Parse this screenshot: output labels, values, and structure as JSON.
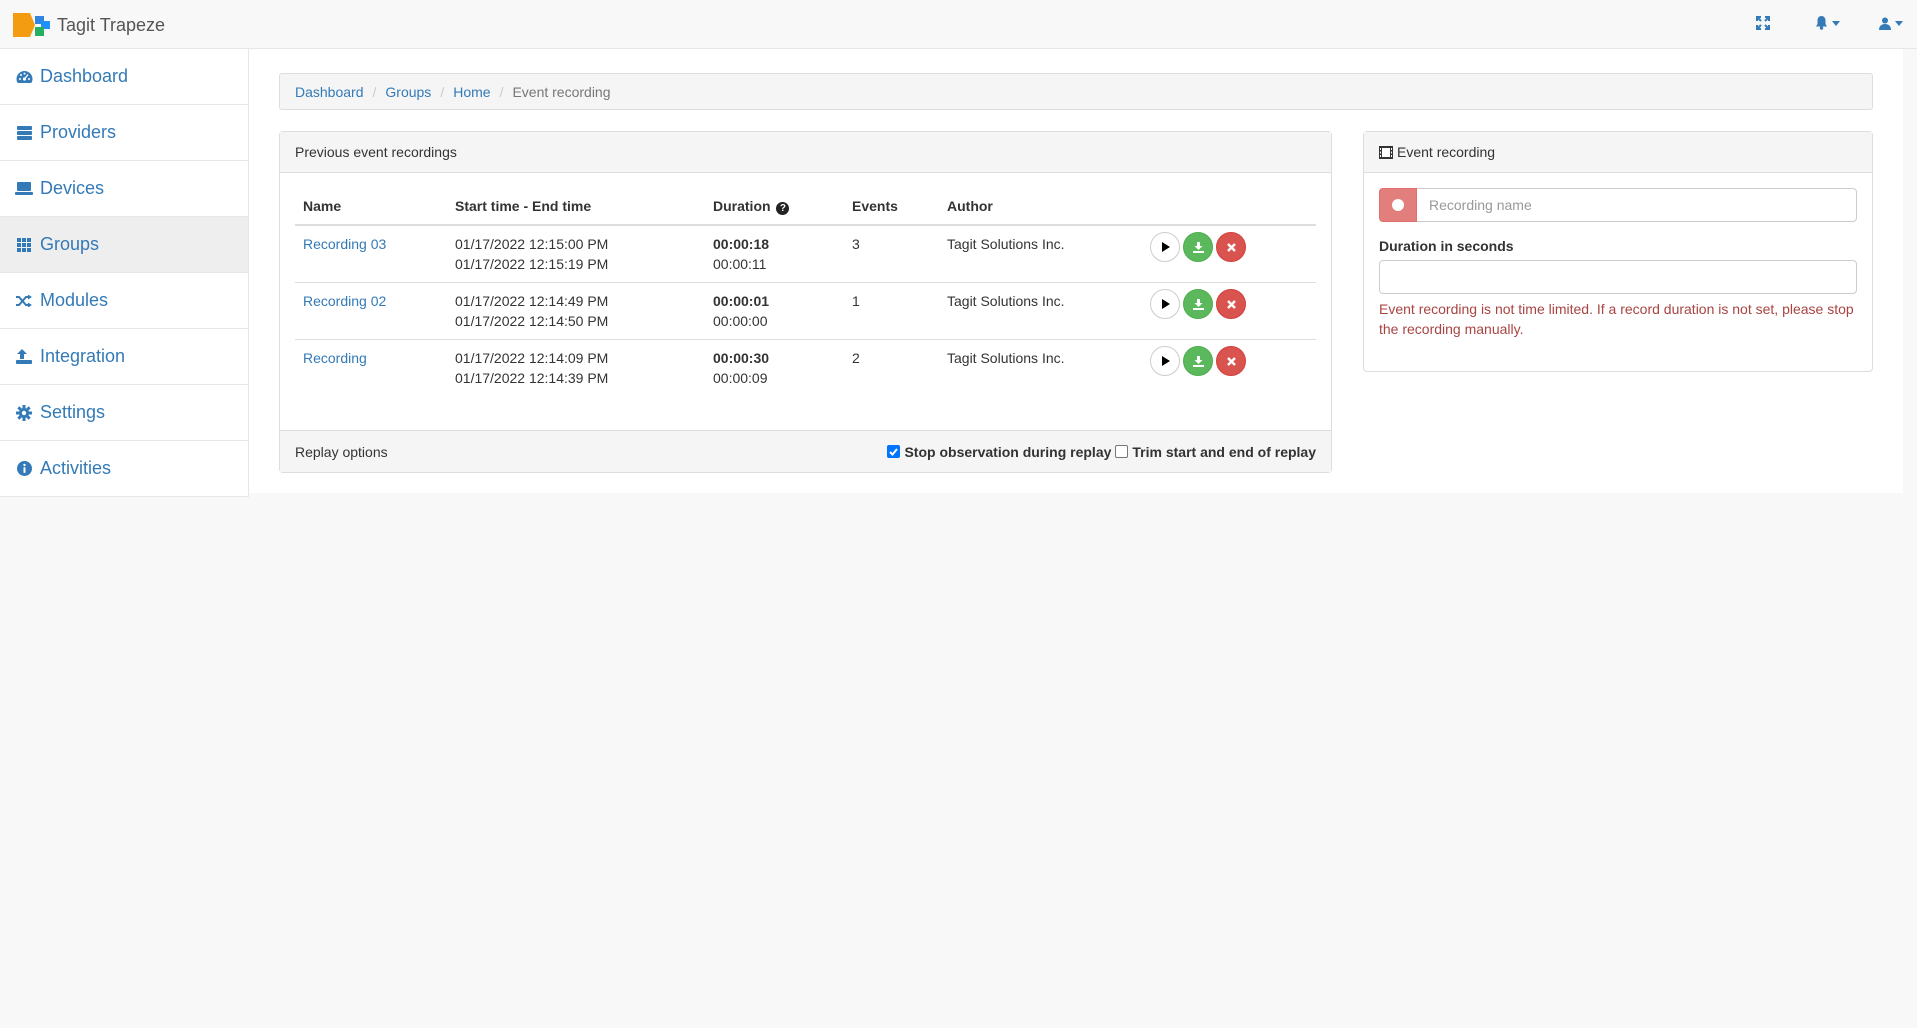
{
  "app": {
    "name": "Tagit Trapeze"
  },
  "colors": {
    "primary": "#337ab7",
    "success": "#5cb85c",
    "danger": "#d9534f",
    "error_text": "#a94442"
  },
  "sidebar": {
    "items": [
      {
        "label": "Dashboard",
        "icon": "dashboard-icon"
      },
      {
        "label": "Providers",
        "icon": "server-icon"
      },
      {
        "label": "Devices",
        "icon": "laptop-icon"
      },
      {
        "label": "Groups",
        "icon": "grid-icon",
        "active": true
      },
      {
        "label": "Modules",
        "icon": "random-icon"
      },
      {
        "label": "Integration",
        "icon": "sign-in-icon"
      },
      {
        "label": "Settings",
        "icon": "gear-icon"
      },
      {
        "label": "Activities",
        "icon": "info-icon"
      }
    ]
  },
  "breadcrumb": {
    "items": [
      "Dashboard",
      "Groups",
      "Home"
    ],
    "current": "Event recording"
  },
  "recordings_panel": {
    "title": "Previous event recordings",
    "columns": {
      "name": "Name",
      "time": "Start time - End time",
      "duration": "Duration",
      "events": "Events",
      "author": "Author"
    },
    "rows": [
      {
        "name": "Recording 03",
        "start": "01/17/2022 12:15:00 PM",
        "end": "01/17/2022 12:15:19 PM",
        "duration": "00:00:18",
        "duration2": "00:00:11",
        "events": "3",
        "author": "Tagit Solutions Inc."
      },
      {
        "name": "Recording 02",
        "start": "01/17/2022 12:14:49 PM",
        "end": "01/17/2022 12:14:50 PM",
        "duration": "00:00:01",
        "duration2": "00:00:00",
        "events": "1",
        "author": "Tagit Solutions Inc."
      },
      {
        "name": "Recording",
        "start": "01/17/2022 12:14:09 PM",
        "end": "01/17/2022 12:14:39 PM",
        "duration": "00:00:30",
        "duration2": "00:00:09",
        "events": "2",
        "author": "Tagit Solutions Inc."
      }
    ],
    "footer": {
      "label": "Replay options",
      "stop_observation": {
        "label": "Stop observation during replay",
        "checked": true
      },
      "trim": {
        "label": "Trim start and end of replay",
        "checked": false
      }
    }
  },
  "event_panel": {
    "title": "Event recording",
    "name_placeholder": "Recording name",
    "name_value": "",
    "duration_label": "Duration in seconds",
    "duration_value": "",
    "help": "Event recording is not time limited. If a record duration is not set, please stop the recording manually."
  }
}
